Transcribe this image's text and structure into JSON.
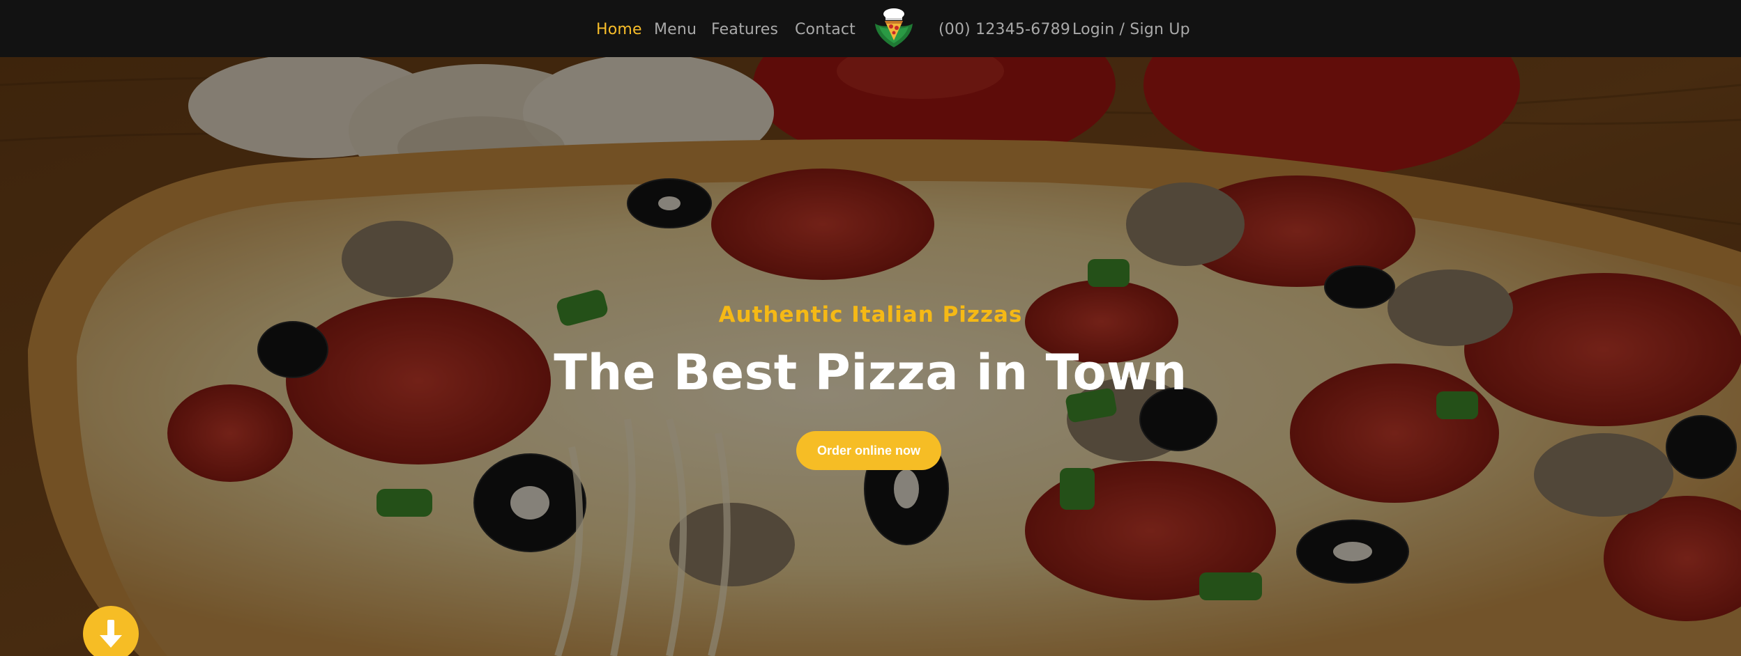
{
  "nav": {
    "links": [
      {
        "label": "Home",
        "active": true
      },
      {
        "label": "Menu",
        "active": false
      },
      {
        "label": "Features",
        "active": false
      },
      {
        "label": "Contact",
        "active": false
      }
    ],
    "phone": "(00) 12345-6789",
    "auth": "Login / Sign Up",
    "logo_icon": "pizza-logo-icon"
  },
  "hero": {
    "subtitle": "Authentic Italian Pizzas",
    "title": "The Best Pizza in Town",
    "cta": "Order online now",
    "scroll_icon": "arrow-down-icon"
  },
  "colors": {
    "accent": "#f6bd25",
    "nav_bg": "#121212",
    "nav_text": "#a9a9a9",
    "heading": "#ffffff"
  }
}
